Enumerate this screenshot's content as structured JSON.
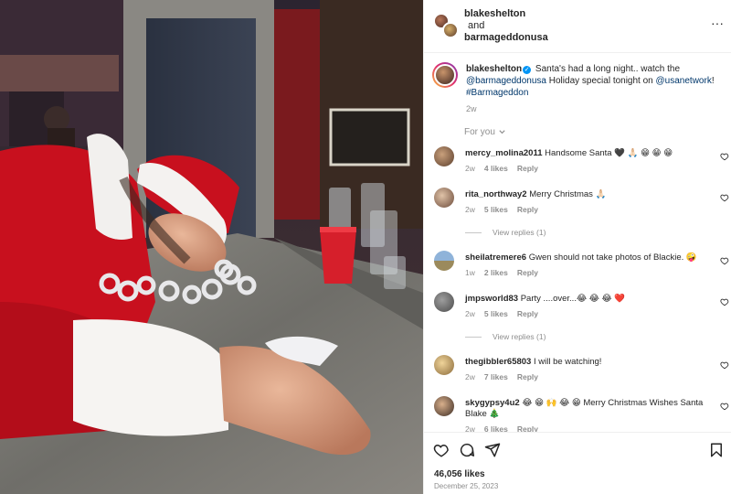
{
  "header": {
    "user1": "blakeshelton",
    "conjunction": "and",
    "user2": "barmageddonusa",
    "more": "···"
  },
  "caption": {
    "username": "blakeshelton",
    "text_before": " Santa's had a long night.. watch the ",
    "mention1": "@barmageddonusa",
    "text_mid": " Holiday special tonight on ",
    "mention2": "@usanetwork",
    "text_end": "!",
    "hashtag": "#Barmageddon",
    "time": "2w"
  },
  "filter_label": "For you",
  "comments": [
    {
      "user": "mercy_molina2011",
      "text": "Handsome Santa 🖤 🙏🏻 😁 😁 😁",
      "time": "2w",
      "likes": "4 likes",
      "reply": "Reply"
    },
    {
      "user": "rita_northway2",
      "text": "Merry Christmas 🙏🏻",
      "time": "2w",
      "likes": "5 likes",
      "reply": "Reply",
      "view_replies": "View replies (1)"
    },
    {
      "user": "sheilatremere6",
      "text": "Gwen should not take photos of Blackie. 🤪",
      "time": "1w",
      "likes": "2 likes",
      "reply": "Reply"
    },
    {
      "user": "jmpsworld83",
      "text": "Party ....over...😂 😂 😂 ❤️",
      "time": "2w",
      "likes": "5 likes",
      "reply": "Reply",
      "view_replies": "View replies (1)"
    },
    {
      "user": "thegibbler65803",
      "text": "I will be watching!",
      "time": "2w",
      "likes": "7 likes",
      "reply": "Reply"
    },
    {
      "user": "skygypsy4u2",
      "text": "😂 😁 🙌 😂 😁  Merry Christmas Wishes Santa Blake 🎄",
      "time": "2w",
      "likes": "6 likes",
      "reply": "Reply"
    }
  ],
  "footer": {
    "likes": "46,056 likes",
    "date": "December 25, 2023"
  },
  "colors": {
    "link": "#00376b",
    "verified": "#0095f6",
    "muted": "#8e8e8e"
  },
  "icons": [
    "heart-icon",
    "comment-icon",
    "share-icon",
    "bookmark-icon",
    "more-icon",
    "verified-icon",
    "chevron-down-icon"
  ]
}
